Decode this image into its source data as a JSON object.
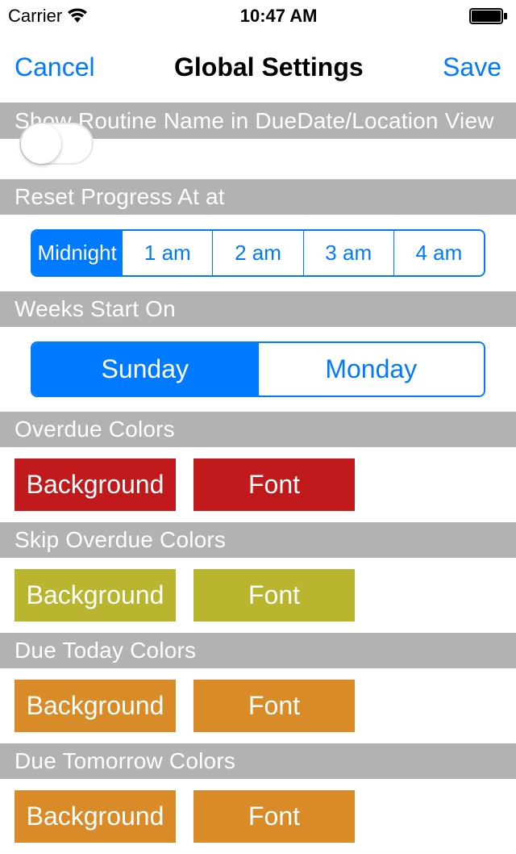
{
  "status": {
    "carrier": "Carrier",
    "time": "10:47 AM"
  },
  "nav": {
    "cancel": "Cancel",
    "title": "Global Settings",
    "save": "Save"
  },
  "sections": {
    "showRoutineName": "Show Routine Name in DueDate/Location View",
    "resetProgress": "Reset Progress At at",
    "weeksStartOn": "Weeks Start On",
    "overdueColors": "Overdue Colors",
    "skipOverdueColors": "Skip Overdue Colors",
    "dueTodayColors": "Due Today Colors",
    "dueTomorrowColors": "Due Tomorrow Colors"
  },
  "resetTimes": {
    "options": [
      "Midnight",
      "1 am",
      "2 am",
      "3 am",
      "4 am"
    ],
    "selected": 0
  },
  "weekStart": {
    "options": [
      "Sunday",
      "Monday"
    ],
    "selected": 0
  },
  "colorButtons": {
    "background": "Background",
    "font": "Font"
  },
  "colors": {
    "overdue": "#c01a1c",
    "skipOverdue": "#b9b52e",
    "dueToday": "#d98b28",
    "dueTomorrow": "#d98b28"
  }
}
